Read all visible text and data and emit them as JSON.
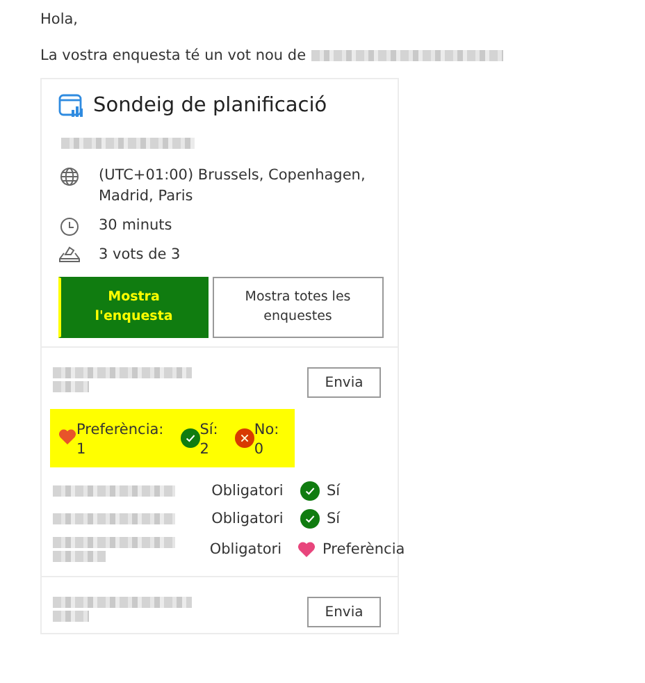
{
  "greeting": "Hola,",
  "intro": {
    "text": "La vostra enquesta té un vot nou de"
  },
  "poll": {
    "title": "Sondeig de planificació",
    "details": [
      {
        "kind": "timezone",
        "text": "(UTC+01:00) Brussels, Copenhagen, Madrid, Paris"
      },
      {
        "kind": "duration",
        "text": "30 minuts"
      },
      {
        "kind": "votes",
        "text": "3 vots de 3"
      }
    ],
    "buttons": [
      {
        "label": "Mostra l'enquesta",
        "primary": true
      },
      {
        "label": "Mostra totes les enquestes",
        "primary": false
      }
    ],
    "slots": [
      {
        "send_label": "Envia",
        "highlighted": true,
        "summary": [
          {
            "kind": "preference",
            "label": "Preferència:",
            "count": "1"
          },
          {
            "kind": "yes",
            "label": "Sí:",
            "count": "2"
          },
          {
            "kind": "no",
            "label": "No:",
            "count": "0"
          }
        ],
        "votes": [
          {
            "requirement": "Obligatori",
            "kind": "yes",
            "answer": "Sí"
          },
          {
            "requirement": "Obligatori",
            "kind": "yes",
            "answer": "Sí"
          },
          {
            "requirement": "Obligatori",
            "kind": "preference",
            "answer": "Preferència"
          }
        ]
      },
      {
        "send_label": "Envia"
      }
    ]
  }
}
